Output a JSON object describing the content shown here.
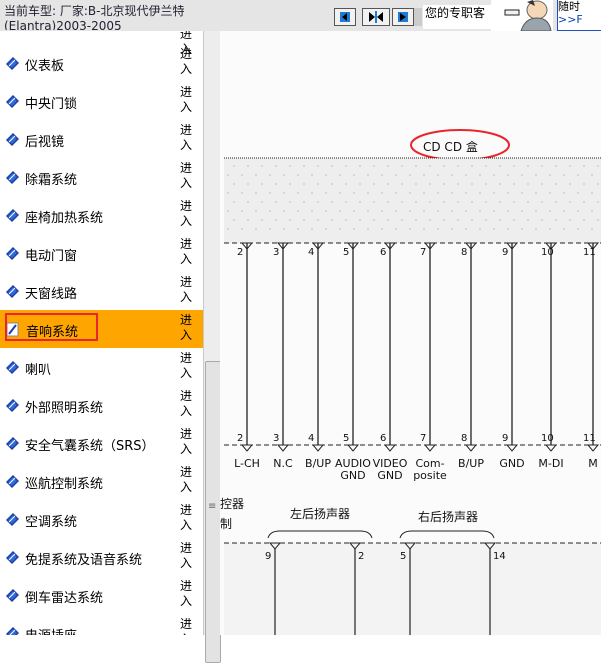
{
  "header": {
    "vehicle_line1": "当前车型:   厂家:B-北京现代伊兰特",
    "vehicle_line2": "(Elantra)2003-2005",
    "nav_prev_icon": "arrow-left-icon",
    "nav_split_icon": "split-arrows-icon",
    "nav_next_icon": "arrow-right-icon",
    "banner_text": "您的专职客",
    "notice_line1": "随时",
    "notice_line2": ">>F"
  },
  "sidebar": {
    "first_enter_label": "进入",
    "items": [
      {
        "label": "仪表板",
        "enter_label": "进入",
        "active": false
      },
      {
        "label": "中央门锁",
        "enter_label": "进入",
        "active": false
      },
      {
        "label": "后视镜",
        "enter_label": "进入",
        "active": false
      },
      {
        "label": "除霜系统",
        "enter_label": "进入",
        "active": false
      },
      {
        "label": "座椅加热系统",
        "enter_label": "进入",
        "active": false
      },
      {
        "label": "电动门窗",
        "enter_label": "进入",
        "active": false
      },
      {
        "label": "天窗线路",
        "enter_label": "进入",
        "active": false
      },
      {
        "label": "音响系统",
        "enter_label": "进入",
        "active": true
      },
      {
        "label": "喇叭",
        "enter_label": "进入",
        "active": false
      },
      {
        "label": "外部照明系统",
        "enter_label": "进入",
        "active": false
      },
      {
        "label": "安全气囊系统（SRS）",
        "enter_label": "进入",
        "active": false
      },
      {
        "label": "巡航控制系统",
        "enter_label": "进入",
        "active": false
      },
      {
        "label": "空调系统",
        "enter_label": "进入",
        "active": false
      },
      {
        "label": "免提系统及语音系统",
        "enter_label": "进入",
        "active": false
      },
      {
        "label": "倒车雷达系统",
        "enter_label": "进入",
        "active": false
      },
      {
        "label": "电源插座",
        "enter_label": "进入",
        "active": false
      }
    ],
    "item_icon": "blue-book-icon"
  },
  "diagram": {
    "cd_box_label": "CD CD 盒",
    "top_pins": [
      "2",
      "3",
      "4",
      "5",
      "6",
      "7",
      "8",
      "9",
      "10",
      "11"
    ],
    "bottom_pins": [
      "2",
      "3",
      "4",
      "5",
      "6",
      "7",
      "8",
      "9",
      "10",
      "11"
    ],
    "signal_labels": [
      [
        "L-CH"
      ],
      [
        "N.C"
      ],
      [
        "B/UP"
      ],
      [
        "AUDIO",
        "GND"
      ],
      [
        "VIDEO",
        "GND"
      ],
      [
        "Com-",
        "posite"
      ],
      [
        "B/UP"
      ],
      [
        "GND"
      ],
      [
        "M-DI"
      ],
      [
        "M"
      ]
    ],
    "left_partial_text_1": "控器",
    "left_partial_text_2": "制",
    "left_rear_speaker_label": "左后扬声器",
    "right_rear_speaker_label": "右后扬声器",
    "speaker_pins": [
      "9",
      "2",
      "5",
      "14"
    ],
    "highlight_color": "#e8262c",
    "active_item_color": "#ffa500"
  }
}
